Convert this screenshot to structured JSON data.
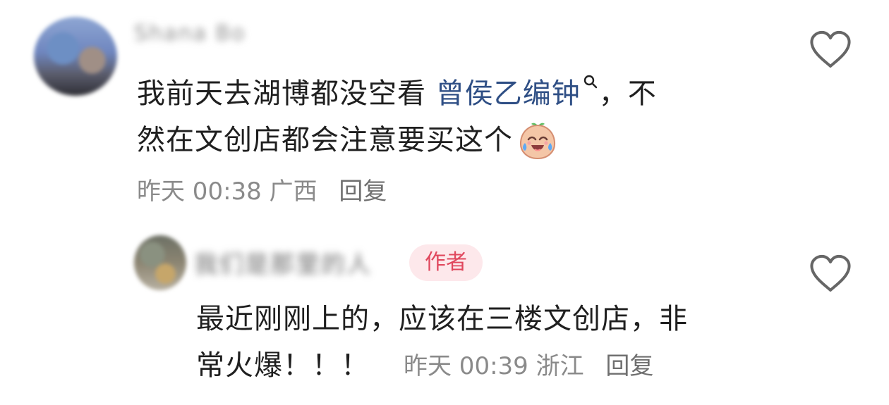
{
  "comments": [
    {
      "username": "Shana Bo",
      "text_prefix": "我前天去湖博都没空看 ",
      "link_text": "曾侯乙编钟",
      "text_line1_suffix": "，不",
      "text_line2": "然在文创店都会注意要买这个",
      "time": "昨天 00:38",
      "location": "广西",
      "reply": "回复"
    },
    {
      "username": "我们是那里的人",
      "badge": "作者",
      "text_line1": "最近刚刚上的，应该在三楼文创店，非",
      "text_line2_prefix": "常火爆！！！",
      "time": "昨天 00:39",
      "location": "浙江",
      "reply": "回复"
    }
  ],
  "icons": {
    "like": "heart-outline-icon",
    "search": "search-icon",
    "emoji": "laugh-cry-emoji-icon"
  },
  "colors": {
    "text": "#1f1f1f",
    "meta": "#8a8a8a",
    "link": "#2f4f85",
    "badge_bg": "#fde8eb",
    "badge_fg": "#e0475d"
  }
}
